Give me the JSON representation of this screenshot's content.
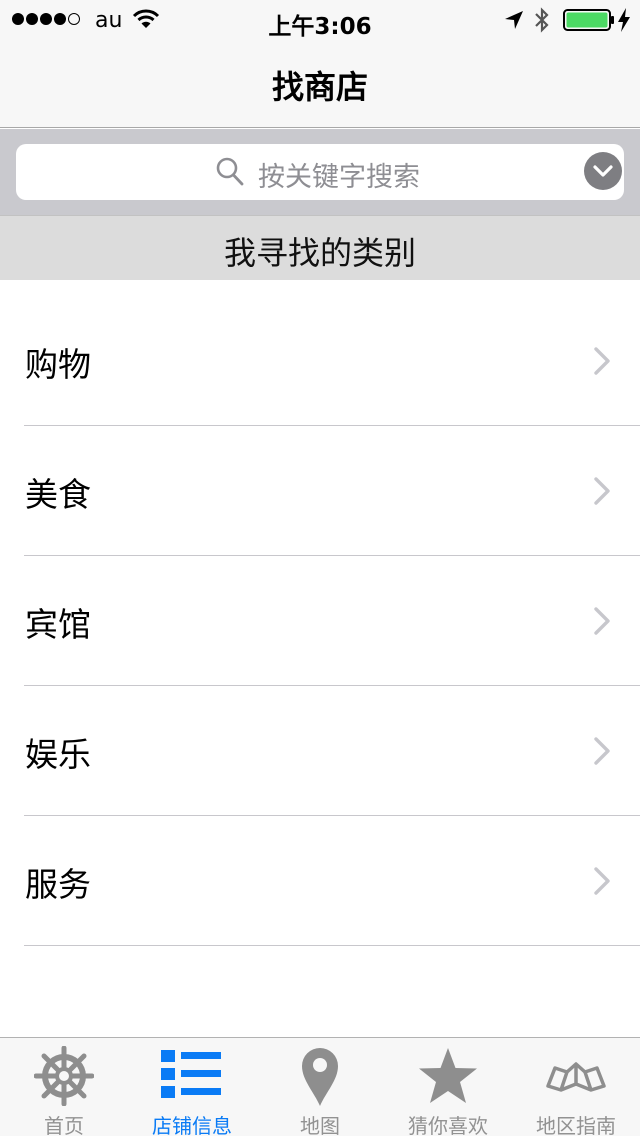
{
  "status_bar": {
    "carrier": "au",
    "time": "上午3:06",
    "signal_bars_filled": 4,
    "signal_bars_total": 5,
    "battery_color": "#4cd964"
  },
  "nav": {
    "title": "找商店"
  },
  "search": {
    "placeholder": "按关键字搜索"
  },
  "section": {
    "title": "我寻找的类别"
  },
  "categories": [
    {
      "label": "购物"
    },
    {
      "label": "美食"
    },
    {
      "label": "宾馆"
    },
    {
      "label": "娱乐"
    },
    {
      "label": "服务"
    }
  ],
  "tabs": [
    {
      "label": "首页",
      "icon": "helm-icon",
      "active": false
    },
    {
      "label": "店铺信息",
      "icon": "list-icon",
      "active": true
    },
    {
      "label": "地图",
      "icon": "map-pin-icon",
      "active": false
    },
    {
      "label": "猜你喜欢",
      "icon": "star-icon",
      "active": false
    },
    {
      "label": "地区指南",
      "icon": "folded-map-icon",
      "active": false
    }
  ],
  "colors": {
    "accent": "#0a7bf5",
    "inactive": "#929292",
    "chevron": "#c7c7cc"
  }
}
